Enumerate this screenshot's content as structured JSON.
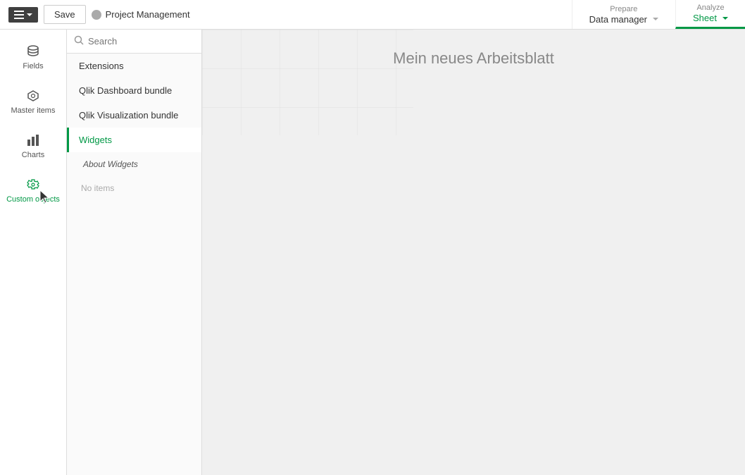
{
  "topbar": {
    "menu_label": "",
    "save_label": "Save",
    "app_name": "Project Management",
    "prepare_label": "Prepare",
    "data_manager_label": "Data manager",
    "analyze_label": "Analyze",
    "sheet_label": "Sheet"
  },
  "sidebar_icons": [
    {
      "id": "fields",
      "icon": "fields-icon",
      "label": "Fields",
      "active": false
    },
    {
      "id": "master-items",
      "icon": "master-icon",
      "label": "Master items",
      "active": false
    },
    {
      "id": "charts",
      "icon": "charts-icon",
      "label": "Charts",
      "active": false
    },
    {
      "id": "custom-objects",
      "icon": "custom-icon",
      "label": "Custom objects",
      "active": true
    }
  ],
  "panel": {
    "search_placeholder": "Search",
    "items": [
      {
        "id": "extensions",
        "label": "Extensions",
        "active": false,
        "style": "normal"
      },
      {
        "id": "qlik-dashboard-bundle",
        "label": "Qlik Dashboard bundle",
        "active": false,
        "style": "normal"
      },
      {
        "id": "qlik-visualization-bundle",
        "label": "Qlik Visualization bundle",
        "active": false,
        "style": "normal"
      },
      {
        "id": "widgets",
        "label": "Widgets",
        "active": true,
        "style": "normal"
      },
      {
        "id": "about-widgets",
        "label": "About Widgets",
        "active": false,
        "style": "sub"
      }
    ],
    "no_items_text": "No items"
  },
  "sheet": {
    "title": "Mein neues Arbeitsblatt"
  },
  "icons": {
    "search": "🔍",
    "fields": "⊞",
    "master": "🔗",
    "charts": "📊",
    "custom": "🧩"
  }
}
